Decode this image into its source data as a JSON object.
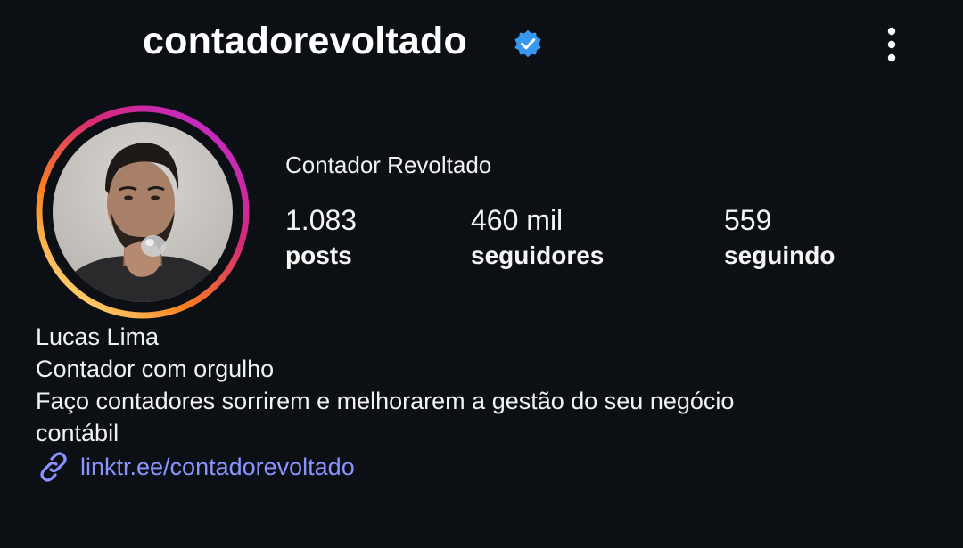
{
  "header": {
    "username": "contadorevoltado",
    "verified_icon": "verified-badge-icon",
    "more_icon": "more-vertical-icon"
  },
  "profile": {
    "display_name": "Contador Revoltado",
    "avatar_ring_colors": [
      "#feda75",
      "#fa7e1e",
      "#d62976",
      "#962fbf"
    ],
    "stats": {
      "posts": {
        "value": "1.083",
        "label": "posts"
      },
      "followers": {
        "value": "460 mil",
        "label": "seguidores"
      },
      "following": {
        "value": "559",
        "label": "seguindo"
      }
    }
  },
  "bio": {
    "name": "Lucas Lima",
    "line1": "Contador com orgulho",
    "line2": "Faço contadores sorrirem e melhorarem a gestão do seu negócio",
    "line3": "contábil",
    "link": "linktr.ee/contadorevoltado",
    "link_icon": "link-icon",
    "link_color": "#8b93ff"
  },
  "colors": {
    "background": "#0c0f14",
    "verified_blue": "#3897f0"
  }
}
